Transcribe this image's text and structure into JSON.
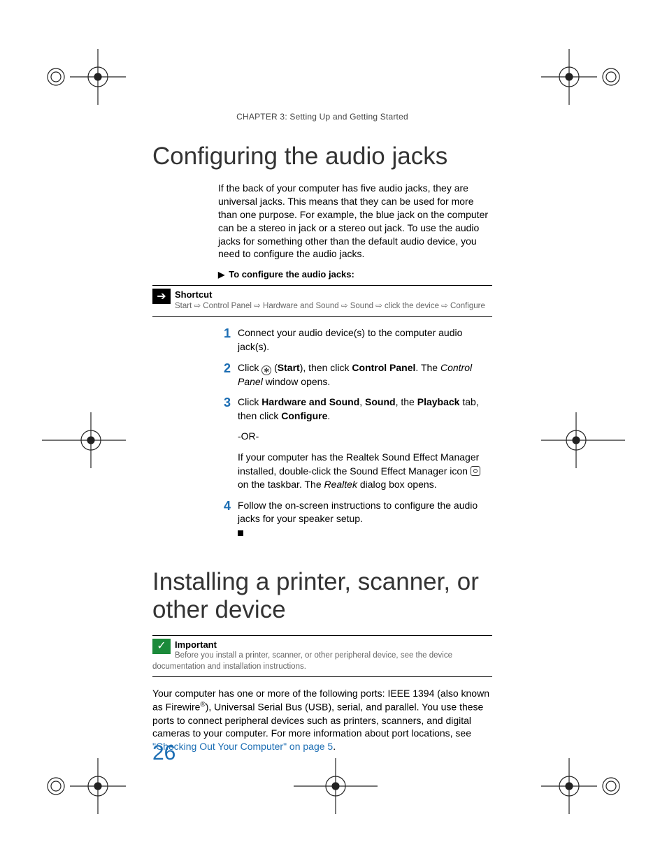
{
  "chapter_prefix": "CHAPTER 3",
  "chapter_title": ": Setting Up and Getting Started",
  "section1_title": "Configuring the audio jacks",
  "section1_intro": "If the back of your computer has five audio jacks, they are universal jacks. This means that they can be used for more than one purpose. For example, the blue jack on the computer can be a stereo in jack or a stereo out jack. To use the audio jacks for something other than the default audio device, you need to configure the audio jacks.",
  "proc_heading": "To configure the audio jacks:",
  "shortcut_label": "Shortcut",
  "shortcut_text": "Start ⇨ Control Panel ⇨ Hardware and Sound ⇨ Sound ⇨ click the device ⇨ Configure",
  "steps": [
    {
      "n": "1",
      "pre": "Connect your audio device(s) to the computer audio jack(s)."
    },
    {
      "n": "2",
      "a": "Click ",
      "b1": "Start",
      "c": "), then click ",
      "b2": "Control Panel",
      "d": ". The ",
      "it": "Control Panel",
      "e": " window opens."
    },
    {
      "n": "3",
      "a": "Click ",
      "b1": "Hardware and Sound",
      "c": ", ",
      "b2": "Sound",
      "d": ", the ",
      "b3": "Playback",
      "e": " tab, then click ",
      "b4": "Configure",
      "f": ".",
      "or": "-OR-",
      "alt_a": "If your computer has the Realtek Sound Effect Manager installed, double-click the Sound Effect Manager icon ",
      "alt_b": " on the taskbar. The ",
      "alt_it": "Realtek",
      "alt_c": " dialog box opens."
    },
    {
      "n": "4",
      "pre": "Follow the on-screen instructions to configure the audio jacks for your speaker setup."
    }
  ],
  "section2_title": "Installing a printer, scanner, or other device",
  "important_label": "Important",
  "important_text": "Before you install a printer, scanner, or other peripheral device, see the device documentation and installation instructions.",
  "section2_para_a": "Your computer has one or more of the following ports: IEEE 1394 (also known as Firewire",
  "section2_para_b": "), Universal Serial Bus (USB), serial, and parallel. You use these ports to connect peripheral devices such as printers, scanners, and digital cameras to your computer. For more information about port locations, see ",
  "section2_link": "\"Checking Out Your Computer\" on page 5",
  "section2_para_c": ".",
  "page_number": "26"
}
